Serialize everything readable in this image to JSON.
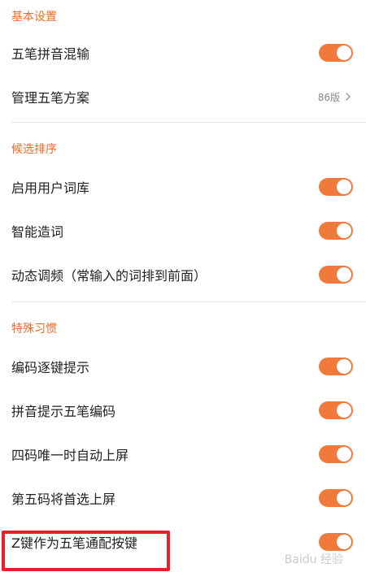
{
  "sections": [
    {
      "header": "基本设置",
      "items": [
        {
          "label": "五笔拼音混输",
          "type": "toggle",
          "on": true
        },
        {
          "label": "管理五笔方案",
          "type": "link",
          "value": "86版"
        }
      ]
    },
    {
      "header": "候选排序",
      "items": [
        {
          "label": "启用用户词库",
          "type": "toggle",
          "on": true
        },
        {
          "label": "智能造词",
          "type": "toggle",
          "on": true
        },
        {
          "label": "动态调频（常输入的词排到前面）",
          "type": "toggle",
          "on": true
        }
      ]
    },
    {
      "header": "特殊习惯",
      "items": [
        {
          "label": "编码逐键提示",
          "type": "toggle",
          "on": true
        },
        {
          "label": "拼音提示五笔编码",
          "type": "toggle",
          "on": true
        },
        {
          "label": "四码唯一时自动上屏",
          "type": "toggle",
          "on": true
        },
        {
          "label": "第五码将首选上屏",
          "type": "toggle",
          "on": true
        },
        {
          "label": "Z键作为五笔通配按键",
          "type": "toggle",
          "on": true
        }
      ]
    }
  ],
  "watermark": "Baidu 经验",
  "colors": {
    "accent": "#f07a3c",
    "header": "#f06a2b",
    "highlight": "#e8202a"
  }
}
